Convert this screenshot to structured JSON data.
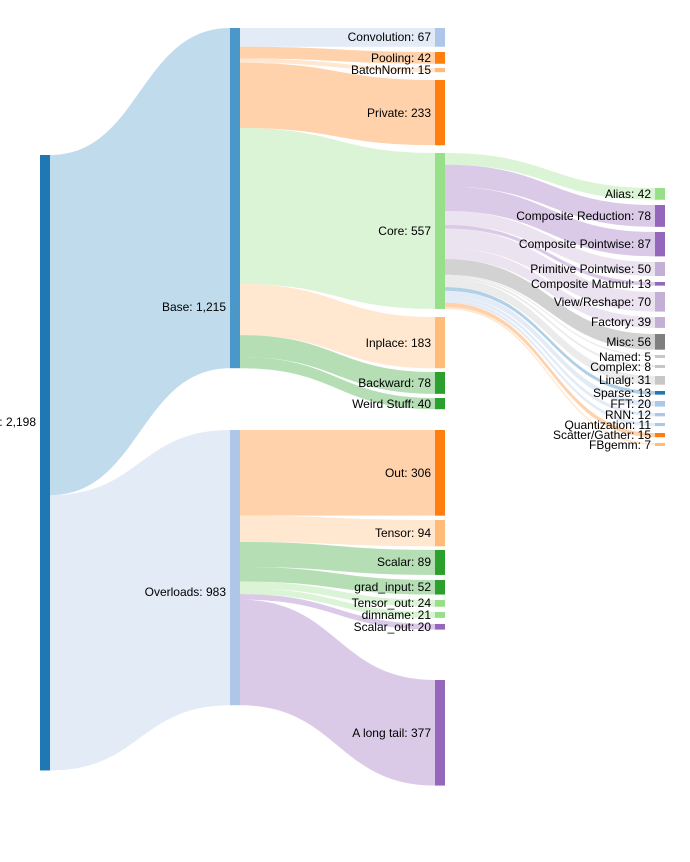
{
  "chart_data": {
    "type": "sankey",
    "title": "",
    "nodes": [
      {
        "id": "total",
        "label": "Total",
        "value": 2198,
        "level": 0
      },
      {
        "id": "base",
        "label": "Base",
        "value": 1215,
        "level": 1
      },
      {
        "id": "overloads",
        "label": "Overloads",
        "value": 983,
        "level": 1
      },
      {
        "id": "convolution",
        "label": "Convolution",
        "value": 67,
        "level": 2
      },
      {
        "id": "pooling",
        "label": "Pooling",
        "value": 42,
        "level": 2
      },
      {
        "id": "batchnorm",
        "label": "BatchNorm",
        "value": 15,
        "level": 2
      },
      {
        "id": "private",
        "label": "Private",
        "value": 233,
        "level": 2
      },
      {
        "id": "core",
        "label": "Core",
        "value": 557,
        "level": 2
      },
      {
        "id": "inplace",
        "label": "Inplace",
        "value": 183,
        "level": 2
      },
      {
        "id": "backward",
        "label": "Backward",
        "value": 78,
        "level": 2
      },
      {
        "id": "weirdstuff",
        "label": "Weird Stuff",
        "value": 40,
        "level": 2
      },
      {
        "id": "out",
        "label": "Out",
        "value": 306,
        "level": 2
      },
      {
        "id": "tensor",
        "label": "Tensor",
        "value": 94,
        "level": 2
      },
      {
        "id": "scalar",
        "label": "Scalar",
        "value": 89,
        "level": 2
      },
      {
        "id": "gradinput",
        "label": "grad_input",
        "value": 52,
        "level": 2
      },
      {
        "id": "tensorout",
        "label": "Tensor_out",
        "value": 24,
        "level": 2
      },
      {
        "id": "dimname",
        "label": "dimname",
        "value": 21,
        "level": 2
      },
      {
        "id": "scalarout",
        "label": "Scalar_out",
        "value": 20,
        "level": 2
      },
      {
        "id": "longtail",
        "label": "A long tail",
        "value": 377,
        "level": 2
      },
      {
        "id": "alias",
        "label": "Alias",
        "value": 42,
        "level": 3
      },
      {
        "id": "compreduction",
        "label": "Composite Reduction",
        "value": 78,
        "level": 3
      },
      {
        "id": "comppointwise",
        "label": "Composite Pointwise",
        "value": 87,
        "level": 3
      },
      {
        "id": "primpointwise",
        "label": "Primitive Pointwise",
        "value": 50,
        "level": 3
      },
      {
        "id": "compmatmul",
        "label": "Composite Matmul",
        "value": 13,
        "level": 3
      },
      {
        "id": "viewreshape",
        "label": "View/Reshape",
        "value": 70,
        "level": 3
      },
      {
        "id": "factory",
        "label": "Factory",
        "value": 39,
        "level": 3
      },
      {
        "id": "misc",
        "label": "Misc",
        "value": 56,
        "level": 3
      },
      {
        "id": "named",
        "label": "Named",
        "value": 5,
        "level": 3
      },
      {
        "id": "complex",
        "label": "Complex",
        "value": 8,
        "level": 3
      },
      {
        "id": "linalg",
        "label": "Linalg",
        "value": 31,
        "level": 3
      },
      {
        "id": "sparse",
        "label": "Sparse",
        "value": 13,
        "level": 3
      },
      {
        "id": "fft",
        "label": "FFT",
        "value": 20,
        "level": 3
      },
      {
        "id": "rnn",
        "label": "RNN",
        "value": 12,
        "level": 3
      },
      {
        "id": "quantization",
        "label": "Quantization",
        "value": 11,
        "level": 3
      },
      {
        "id": "scattergather",
        "label": "Scatter/Gather",
        "value": 15,
        "level": 3
      },
      {
        "id": "fbgemm",
        "label": "FBgemm",
        "value": 7,
        "level": 3
      }
    ],
    "links": [
      {
        "source": "total",
        "target": "base",
        "value": 1215
      },
      {
        "source": "total",
        "target": "overloads",
        "value": 983
      },
      {
        "source": "base",
        "target": "convolution",
        "value": 67
      },
      {
        "source": "base",
        "target": "pooling",
        "value": 42
      },
      {
        "source": "base",
        "target": "batchnorm",
        "value": 15
      },
      {
        "source": "base",
        "target": "private",
        "value": 233
      },
      {
        "source": "base",
        "target": "core",
        "value": 557
      },
      {
        "source": "base",
        "target": "inplace",
        "value": 183
      },
      {
        "source": "base",
        "target": "backward",
        "value": 78
      },
      {
        "source": "base",
        "target": "weirdstuff",
        "value": 40
      },
      {
        "source": "overloads",
        "target": "out",
        "value": 306
      },
      {
        "source": "overloads",
        "target": "tensor",
        "value": 94
      },
      {
        "source": "overloads",
        "target": "scalar",
        "value": 89
      },
      {
        "source": "overloads",
        "target": "gradinput",
        "value": 52
      },
      {
        "source": "overloads",
        "target": "tensorout",
        "value": 24
      },
      {
        "source": "overloads",
        "target": "dimname",
        "value": 21
      },
      {
        "source": "overloads",
        "target": "scalarout",
        "value": 20
      },
      {
        "source": "overloads",
        "target": "longtail",
        "value": 377
      },
      {
        "source": "core",
        "target": "alias",
        "value": 42
      },
      {
        "source": "core",
        "target": "compreduction",
        "value": 78
      },
      {
        "source": "core",
        "target": "comppointwise",
        "value": 87
      },
      {
        "source": "core",
        "target": "primpointwise",
        "value": 50
      },
      {
        "source": "core",
        "target": "compmatmul",
        "value": 13
      },
      {
        "source": "core",
        "target": "viewreshape",
        "value": 70
      },
      {
        "source": "core",
        "target": "factory",
        "value": 39
      },
      {
        "source": "core",
        "target": "misc",
        "value": 56
      },
      {
        "source": "core",
        "target": "named",
        "value": 5
      },
      {
        "source": "core",
        "target": "complex",
        "value": 8
      },
      {
        "source": "core",
        "target": "linalg",
        "value": 31
      },
      {
        "source": "core",
        "target": "sparse",
        "value": 13
      },
      {
        "source": "core",
        "target": "fft",
        "value": 20
      },
      {
        "source": "core",
        "target": "rnn",
        "value": 12
      },
      {
        "source": "core",
        "target": "quantization",
        "value": 11
      },
      {
        "source": "core",
        "target": "scattergather",
        "value": 15
      },
      {
        "source": "core",
        "target": "fbgemm",
        "value": 7
      }
    ]
  },
  "colors": {
    "total_bar": "#1f77b4",
    "base_bar": "#4a98c9",
    "overloads_bar": "#aec7e8",
    "convolution": "#aec7e8",
    "pooling": "#ff7f0e",
    "batchnorm": "#ffbb78",
    "private": "#ff7f0e",
    "core": "#98df8a",
    "inplace": "#ffbb78",
    "backward": "#2ca02c",
    "weirdstuff": "#2ca02c",
    "out": "#ff7f0e",
    "tensor": "#ffbb78",
    "scalar": "#2ca02c",
    "gradinput": "#2ca02c",
    "tensorout": "#98df8a",
    "dimname": "#98df8a",
    "scalarout": "#9467bd",
    "longtail": "#9467bd",
    "alias": "#98df8a",
    "compreduction": "#9467bd",
    "comppointwise": "#9467bd",
    "primpointwise": "#c5b0d5",
    "compmatmul": "#9467bd",
    "viewreshape": "#c5b0d5",
    "factory": "#c5b0d5",
    "misc": "#7f7f7f",
    "named": "#c7c7c7",
    "complex": "#c7c7c7",
    "linalg": "#c7c7c7",
    "sparse": "#1f77b4",
    "fft": "#aec7e8",
    "rnn": "#aec7e8",
    "quantization": "#aec7e8",
    "scattergather": "#ff7f0e",
    "fbgemm": "#ffbb78"
  }
}
